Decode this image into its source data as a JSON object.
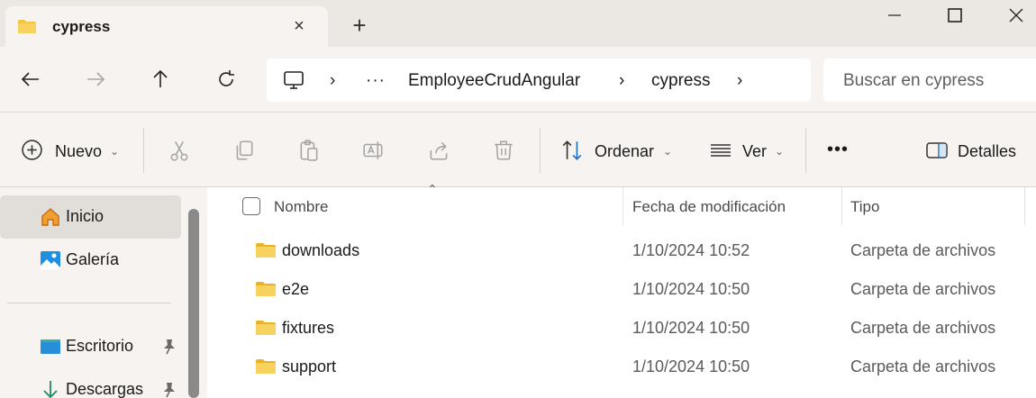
{
  "tab": {
    "title": "cypress",
    "folder_icon": "folder-icon",
    "close_icon": "close-icon",
    "new_tab_icon": "plus-icon"
  },
  "window_controls": [
    "minimize-icon",
    "maximize-icon",
    "close-icon"
  ],
  "navigation": {
    "buttons": [
      "back-arrow-icon",
      "forward-arrow-icon",
      "up-arrow-icon",
      "refresh-icon"
    ]
  },
  "address_bar": {
    "root_icon": "this-pc-icon",
    "overflow": "···",
    "crumbs": [
      "EmployeeCrudAngular",
      "cypress"
    ]
  },
  "search": {
    "placeholder": "Buscar en cypress"
  },
  "toolbar": {
    "new_label": "Nuevo",
    "sort_label": "Ordenar",
    "view_label": "Ver",
    "more_label": "•••",
    "details_label": "Detalles",
    "action_icons": [
      "cut-icon",
      "copy-icon",
      "paste-icon",
      "rename-icon",
      "share-icon",
      "delete-icon"
    ]
  },
  "sidebar": {
    "items": [
      {
        "label": "Inicio",
        "icon": "home-icon",
        "selected": true
      },
      {
        "label": "Galería",
        "icon": "gallery-icon",
        "selected": false
      },
      {
        "label": "Escritorio",
        "icon": "desktop-icon",
        "pinned": true
      },
      {
        "label": "Descargas",
        "icon": "download-icon",
        "pinned": true
      }
    ]
  },
  "file_list": {
    "columns": [
      "Nombre",
      "Fecha de modificación",
      "Tipo"
    ],
    "rows": [
      {
        "name": "downloads",
        "modified": "1/10/2024 10:52",
        "type": "Carpeta de archivos"
      },
      {
        "name": "e2e",
        "modified": "1/10/2024 10:50",
        "type": "Carpeta de archivos"
      },
      {
        "name": "fixtures",
        "modified": "1/10/2024 10:50",
        "type": "Carpeta de archivos"
      },
      {
        "name": "support",
        "modified": "1/10/2024 10:50",
        "type": "Carpeta de archivos"
      }
    ]
  },
  "colors": {
    "chrome_bg": "#f6f3f0",
    "titlebar_bg": "#ebe7e3",
    "folder_yellow": "#f4c542",
    "accent_blue": "#1f6fc5"
  }
}
